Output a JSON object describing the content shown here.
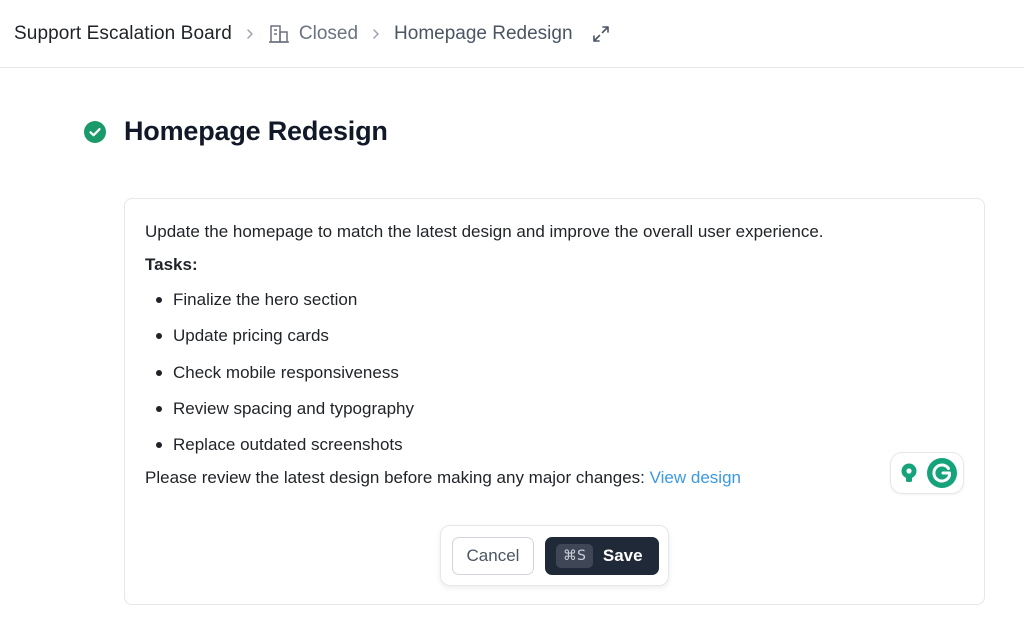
{
  "breadcrumb": {
    "root": "Support Escalation Board",
    "status_icon": "building-icon",
    "status": "Closed",
    "current": "Homepage Redesign"
  },
  "page": {
    "title": "Homepage Redesign",
    "status_icon": "check-circle-icon",
    "status_color": "#1a9a6b"
  },
  "editor": {
    "description": "Update the homepage to match the latest design and improve the overall user experience.",
    "tasks_label": "Tasks:",
    "tasks": [
      "Finalize the hero section",
      "Update pricing cards",
      "Check mobile responsiveness",
      "Review spacing and typography",
      "Replace outdated screenshots"
    ],
    "footer_text": "Please review the latest design before making any major changes: ",
    "link_text": "View design",
    "link_color": "#3b9ae1"
  },
  "actions": {
    "cancel_label": "Cancel",
    "save_shortcut": "⌘S",
    "save_label": "Save"
  },
  "widget": {
    "name": "grammarly",
    "color": "#15a37c"
  }
}
